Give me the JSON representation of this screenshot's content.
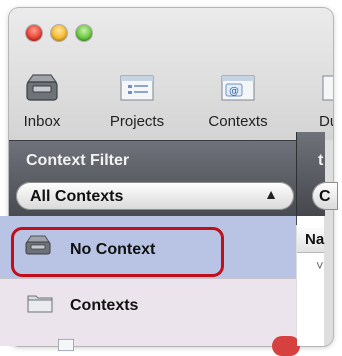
{
  "toolbar": {
    "items": [
      {
        "label": "Inbox",
        "icon": "inbox-icon"
      },
      {
        "label": "Projects",
        "icon": "projects-icon"
      },
      {
        "label": "Contexts",
        "icon": "contexts-icon"
      },
      {
        "label": "Du",
        "icon": "due-icon"
      }
    ]
  },
  "sidebar": {
    "title": "Context Filter",
    "filter": {
      "selected": "All Contexts"
    },
    "items": [
      {
        "label": "No Context",
        "icon": "no-context-tray-icon",
        "selected": true
      },
      {
        "label": "Contexts",
        "icon": "folder-icon",
        "selected": false
      }
    ]
  },
  "main": {
    "partial_title": "t",
    "partial_select": "C",
    "partial_column_header": "Na",
    "partial_row_text": "˅"
  },
  "colors": {
    "selection": "#b9c3e3",
    "highlight_ring": "#c20d1b",
    "sidebar_header": "#55575d",
    "sidebar_bg": "#ece4ec"
  }
}
